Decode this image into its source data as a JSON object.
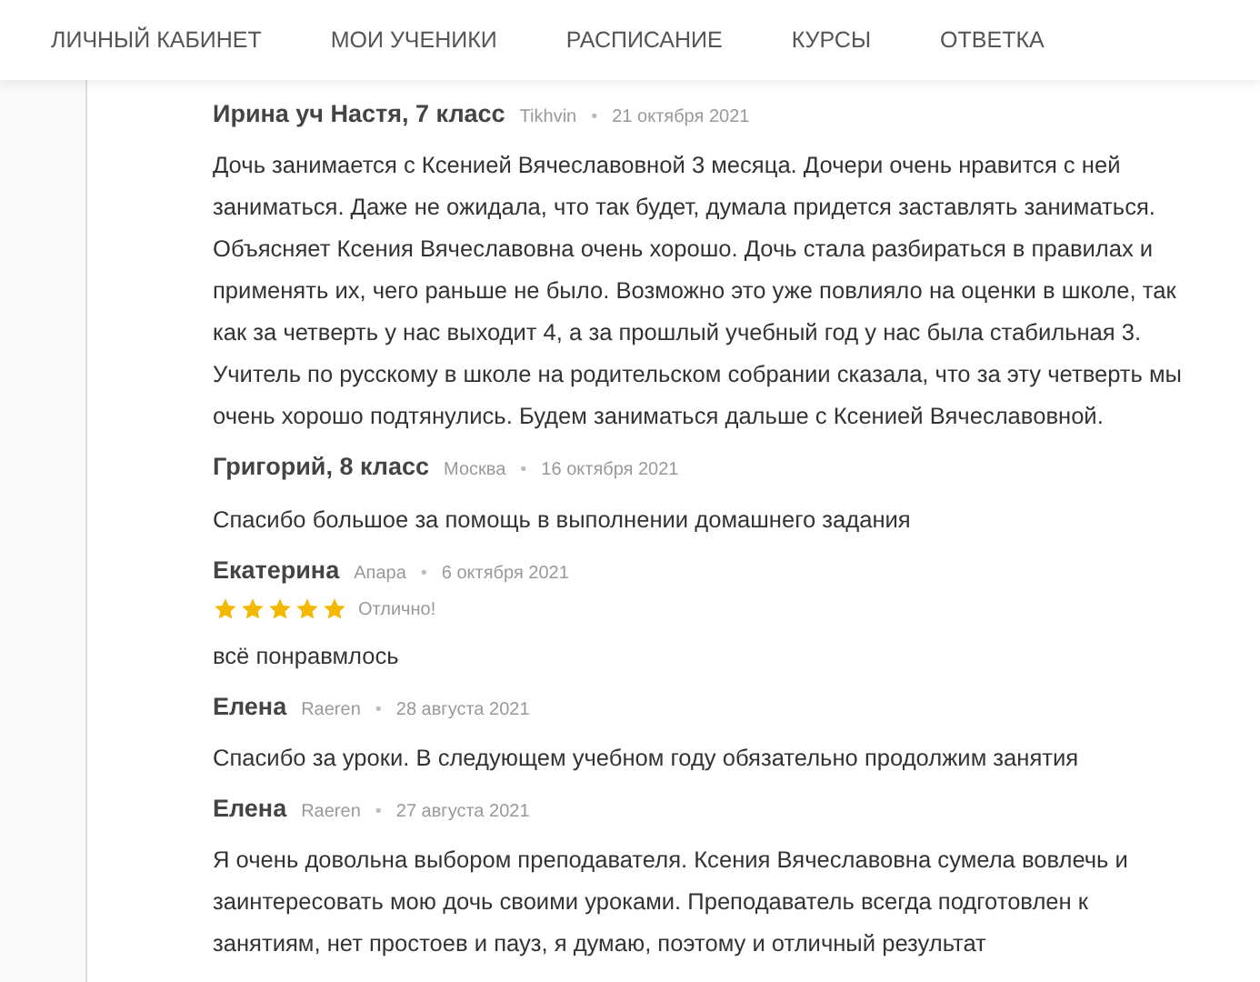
{
  "nav": {
    "items": [
      {
        "label": "ЛИЧНЫЙ КАБИНЕТ"
      },
      {
        "label": "МОИ УЧЕНИКИ"
      },
      {
        "label": "РАСПИСАНИЕ"
      },
      {
        "label": "КУРСЫ"
      },
      {
        "label": "ОТВЕТКА"
      }
    ]
  },
  "reviews": [
    {
      "author": "Ирина уч Настя, 7 класс",
      "city": "Tikhvin",
      "separator": "•",
      "date": "21 октября 2021",
      "text": "Дочь занимается с Ксенией Вячеславовной 3 месяца. Дочери очень нравится с ней заниматься. Даже не ожидала, что так будет, думала придется заставлять заниматься. Объясняет Ксения Вячеславовна очень хорошо. Дочь стала разбираться в правилах и применять их, чего раньше не было. Возможно это уже повлияло на оценки в школе, так как за четверть у нас выходит 4, а за прошлый учебный год у нас была стабильная 3. Учитель по русскому в школе на родительском собрании сказала, что за эту четверть мы очень хорошо подтянулись. Будем заниматься дальше с Ксенией Вячеславовной."
    },
    {
      "author": "Григорий, 8 класс",
      "city": "Москва",
      "separator": "•",
      "date": "16 октября 2021",
      "text": "Спасибо большое за помощь в выполнении домашнего задания"
    },
    {
      "author": "Екатерина",
      "city": "Апара",
      "separator": "•",
      "date": "6 октября 2021",
      "stars": 5,
      "rating_label": "Отлично!",
      "text": "всё понравмлось"
    },
    {
      "author": "Елена",
      "city": "Raeren",
      "separator": "•",
      "date": "28 августа 2021",
      "text": "Спасибо за уроки. В следующем учебном году обязательно продолжим занятия"
    },
    {
      "author": "Елена",
      "city": "Raeren",
      "separator": "•",
      "date": "27 августа 2021",
      "text": "Я очень довольна выбором преподавателя. Ксения Вячеславовна сумела вовлечь и заинтересовать мою дочь своими уроками. Преподаватель всегда подготовлен к занятиям, нет простоев и пауз, я думаю, поэтому и отличный результат"
    }
  ]
}
